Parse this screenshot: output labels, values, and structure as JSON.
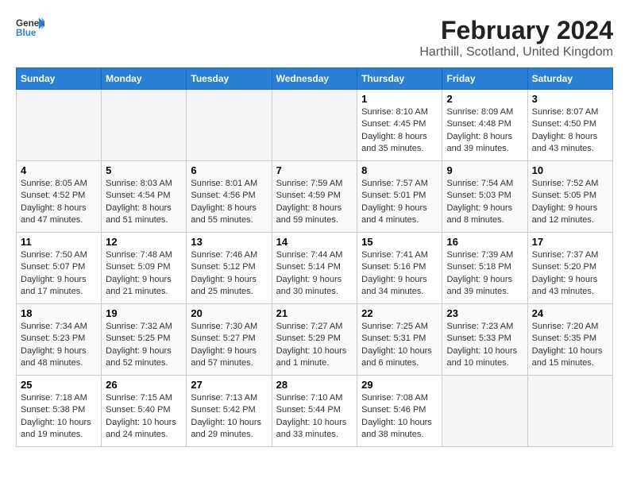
{
  "header": {
    "logo_general": "General",
    "logo_blue": "Blue",
    "month_title": "February 2024",
    "location": "Harthill, Scotland, United Kingdom"
  },
  "days_of_week": [
    "Sunday",
    "Monday",
    "Tuesday",
    "Wednesday",
    "Thursday",
    "Friday",
    "Saturday"
  ],
  "weeks": [
    [
      {
        "day": "",
        "empty": true
      },
      {
        "day": "",
        "empty": true
      },
      {
        "day": "",
        "empty": true
      },
      {
        "day": "",
        "empty": true
      },
      {
        "day": "1",
        "sunrise": "8:10 AM",
        "sunset": "4:45 PM",
        "daylight": "8 hours and 35 minutes."
      },
      {
        "day": "2",
        "sunrise": "8:09 AM",
        "sunset": "4:48 PM",
        "daylight": "8 hours and 39 minutes."
      },
      {
        "day": "3",
        "sunrise": "8:07 AM",
        "sunset": "4:50 PM",
        "daylight": "8 hours and 43 minutes."
      }
    ],
    [
      {
        "day": "4",
        "sunrise": "8:05 AM",
        "sunset": "4:52 PM",
        "daylight": "8 hours and 47 minutes."
      },
      {
        "day": "5",
        "sunrise": "8:03 AM",
        "sunset": "4:54 PM",
        "daylight": "8 hours and 51 minutes."
      },
      {
        "day": "6",
        "sunrise": "8:01 AM",
        "sunset": "4:56 PM",
        "daylight": "8 hours and 55 minutes."
      },
      {
        "day": "7",
        "sunrise": "7:59 AM",
        "sunset": "4:59 PM",
        "daylight": "8 hours and 59 minutes."
      },
      {
        "day": "8",
        "sunrise": "7:57 AM",
        "sunset": "5:01 PM",
        "daylight": "9 hours and 4 minutes."
      },
      {
        "day": "9",
        "sunrise": "7:54 AM",
        "sunset": "5:03 PM",
        "daylight": "9 hours and 8 minutes."
      },
      {
        "day": "10",
        "sunrise": "7:52 AM",
        "sunset": "5:05 PM",
        "daylight": "9 hours and 12 minutes."
      }
    ],
    [
      {
        "day": "11",
        "sunrise": "7:50 AM",
        "sunset": "5:07 PM",
        "daylight": "9 hours and 17 minutes."
      },
      {
        "day": "12",
        "sunrise": "7:48 AM",
        "sunset": "5:09 PM",
        "daylight": "9 hours and 21 minutes."
      },
      {
        "day": "13",
        "sunrise": "7:46 AM",
        "sunset": "5:12 PM",
        "daylight": "9 hours and 25 minutes."
      },
      {
        "day": "14",
        "sunrise": "7:44 AM",
        "sunset": "5:14 PM",
        "daylight": "9 hours and 30 minutes."
      },
      {
        "day": "15",
        "sunrise": "7:41 AM",
        "sunset": "5:16 PM",
        "daylight": "9 hours and 34 minutes."
      },
      {
        "day": "16",
        "sunrise": "7:39 AM",
        "sunset": "5:18 PM",
        "daylight": "9 hours and 39 minutes."
      },
      {
        "day": "17",
        "sunrise": "7:37 AM",
        "sunset": "5:20 PM",
        "daylight": "9 hours and 43 minutes."
      }
    ],
    [
      {
        "day": "18",
        "sunrise": "7:34 AM",
        "sunset": "5:23 PM",
        "daylight": "9 hours and 48 minutes."
      },
      {
        "day": "19",
        "sunrise": "7:32 AM",
        "sunset": "5:25 PM",
        "daylight": "9 hours and 52 minutes."
      },
      {
        "day": "20",
        "sunrise": "7:30 AM",
        "sunset": "5:27 PM",
        "daylight": "9 hours and 57 minutes."
      },
      {
        "day": "21",
        "sunrise": "7:27 AM",
        "sunset": "5:29 PM",
        "daylight": "10 hours and 1 minute."
      },
      {
        "day": "22",
        "sunrise": "7:25 AM",
        "sunset": "5:31 PM",
        "daylight": "10 hours and 6 minutes."
      },
      {
        "day": "23",
        "sunrise": "7:23 AM",
        "sunset": "5:33 PM",
        "daylight": "10 hours and 10 minutes."
      },
      {
        "day": "24",
        "sunrise": "7:20 AM",
        "sunset": "5:35 PM",
        "daylight": "10 hours and 15 minutes."
      }
    ],
    [
      {
        "day": "25",
        "sunrise": "7:18 AM",
        "sunset": "5:38 PM",
        "daylight": "10 hours and 19 minutes."
      },
      {
        "day": "26",
        "sunrise": "7:15 AM",
        "sunset": "5:40 PM",
        "daylight": "10 hours and 24 minutes."
      },
      {
        "day": "27",
        "sunrise": "7:13 AM",
        "sunset": "5:42 PM",
        "daylight": "10 hours and 29 minutes."
      },
      {
        "day": "28",
        "sunrise": "7:10 AM",
        "sunset": "5:44 PM",
        "daylight": "10 hours and 33 minutes."
      },
      {
        "day": "29",
        "sunrise": "7:08 AM",
        "sunset": "5:46 PM",
        "daylight": "10 hours and 38 minutes."
      },
      {
        "day": "",
        "empty": true
      },
      {
        "day": "",
        "empty": true
      }
    ]
  ],
  "labels": {
    "sunrise_prefix": "Sunrise: ",
    "sunset_prefix": "Sunset: ",
    "daylight_prefix": "Daylight: "
  }
}
